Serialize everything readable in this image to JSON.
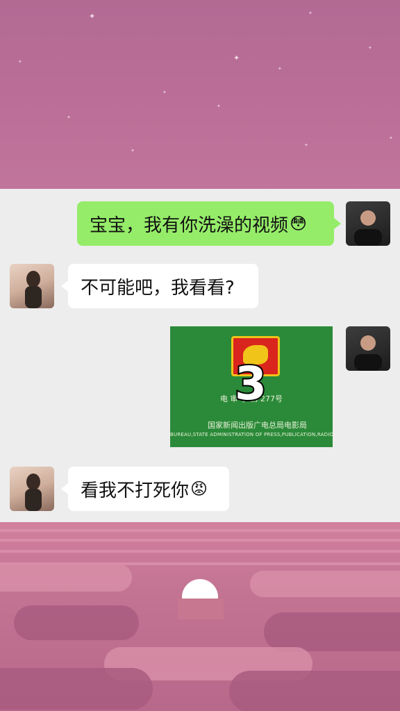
{
  "messages": [
    {
      "side": "right",
      "type": "text",
      "text": "宝宝，我有你洗澡的视频",
      "emoji": "😳"
    },
    {
      "side": "left",
      "type": "text",
      "text": "不可能吧，我看看?"
    },
    {
      "side": "right",
      "type": "video",
      "cert_text": "电 审 字 第 277号",
      "bureau_cn": "国家新闻出版广电总局电影局",
      "bureau_en": "BUREAU,STATE ADMINISTRATION OF PRESS,PUBLICATION,RADIO,FILM AND",
      "countdown": "3"
    },
    {
      "side": "left",
      "type": "text",
      "text": "看我不打死你",
      "emoji": "😡"
    }
  ],
  "icons": {
    "emoji_blush": "flushed-face-icon",
    "emoji_angry": "angry-face-icon"
  },
  "colors": {
    "sky": "#b76b93",
    "chat_bg": "#ededed",
    "bubble_sent": "#95ec69",
    "bubble_received": "#ffffff",
    "video_bg": "#2b8a39",
    "emblem_red": "#d9251d",
    "emblem_gold": "#f0c419"
  }
}
